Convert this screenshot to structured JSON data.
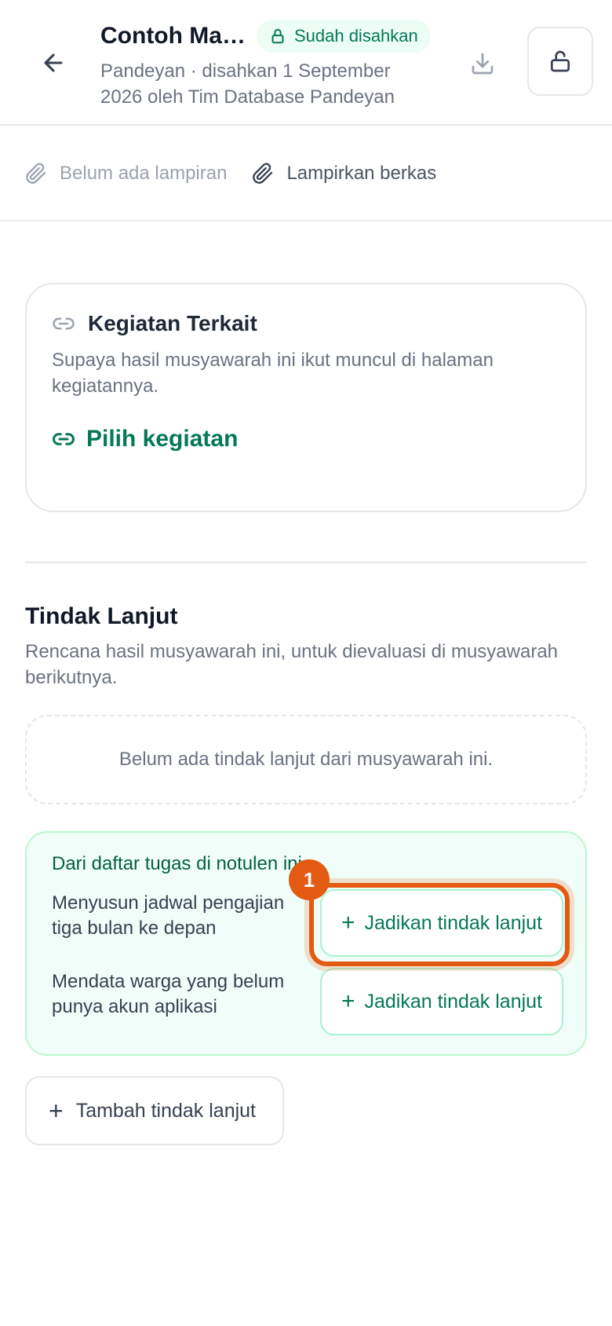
{
  "header": {
    "title": "Contoh Ma…",
    "badge_label": "Sudah disahkan",
    "subtitle": "Pandeyan · disahkan 1 September 2026 oleh Tim Database Pandeyan",
    "icons": {
      "back": "arrow-left-icon",
      "badge": "lock-icon",
      "download": "download-icon",
      "unlock": "unlock-icon"
    }
  },
  "attachments": {
    "empty_text": "Belum ada lampiran",
    "attach_label": "Lampirkan berkas",
    "icon": "paperclip-icon"
  },
  "related": {
    "title": "Kegiatan Terkait",
    "description": "Supaya hasil musyawarah ini ikut muncul di halaman kegiatannya.",
    "pick_label": "Pilih kegiatan",
    "icon": "link-icon"
  },
  "followup": {
    "title": "Tindak Lanjut",
    "description": "Rencana hasil musyawarah ini, untuk dievaluasi di musyawarah berikutnya.",
    "empty_text": "Belum ada tindak lanjut dari musyawarah ini.",
    "suggestions_title": "Dari daftar tugas di notulen ini",
    "tasks": [
      {
        "text": "Menyusun jadwal pengajian tiga bulan ke depan",
        "action": "Jadikan tindak lanjut"
      },
      {
        "text": "Mendata warga yang belum punya akun aplikasi",
        "action": "Jadikan tindak lanjut"
      }
    ],
    "add_label": "Tambah tindak lanjut"
  },
  "annotation": {
    "marker": "1"
  },
  "colors": {
    "accent": "#047857",
    "highlight": "#e35a12",
    "suggest_bg": "#f0fdf8"
  }
}
